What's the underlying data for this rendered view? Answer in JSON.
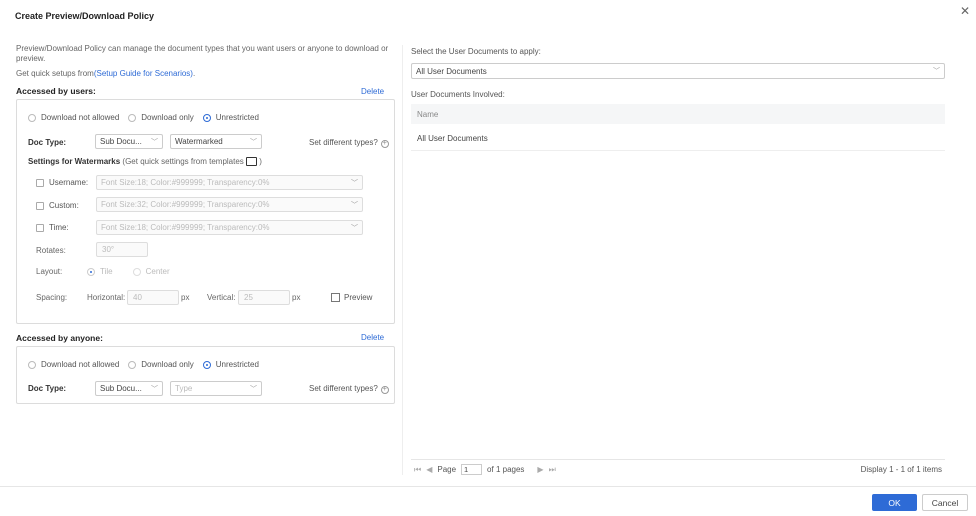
{
  "dialog": {
    "title": "Create Preview/Download Policy",
    "description": "Preview/Download Policy can manage the document types that you want users or anyone to download or preview.",
    "quick_setup_prefix": "Get quick setups from",
    "quick_setup_link": "(Setup Guide for Scenarios)",
    "quick_setup_suffix": "."
  },
  "users_section": {
    "title": "Accessed by users:",
    "delete": "Delete",
    "radios": [
      "Download not allowed",
      "Download only",
      "Unrestricted"
    ],
    "selected_radio": "Unrestricted",
    "doc_type_label": "Doc Type:",
    "doc_type_value": "Sub Docu...",
    "watermark_value": "Watermarked",
    "set_different": "Set different types?",
    "watermark_settings_title": "Settings for Watermarks",
    "watermark_settings_hint": "(Get quick settings from templates",
    "watermark_settings_hint_end": ")",
    "username_label": "Username:",
    "username_value": "Font Size:18;  Color:#999999;  Transparency:0%",
    "custom_label": "Custom:",
    "custom_value": "Font Size:32;  Color:#999999;  Transparency:0%",
    "time_label": "Time:",
    "time_value": "Font Size:18;  Color:#999999;  Transparency:0%",
    "rotates_label": "Rotates:",
    "rotates_value": "30°",
    "layout_label": "Layout:",
    "layout_tile": "Tile",
    "layout_center": "Center",
    "spacing_label": "Spacing:",
    "horizontal_label": "Horizontal:",
    "horizontal_value": "40",
    "horizontal_unit": "px",
    "vertical_label": "Vertical:",
    "vertical_value": "25",
    "vertical_unit": "px",
    "preview": "Preview"
  },
  "anyone_section": {
    "title": "Accessed by anyone:",
    "delete": "Delete",
    "radios": [
      "Download not allowed",
      "Download only",
      "Unrestricted"
    ],
    "selected_radio": "Unrestricted",
    "doc_type_label": "Doc Type:",
    "doc_type_value": "Sub Docu...",
    "type_placeholder": "Type",
    "set_different": "Set different types?"
  },
  "right_panel": {
    "select_label": "Select the User Documents to apply:",
    "select_value": "All User Documents",
    "involved_label": "User Documents Involved:",
    "table_header": "Name",
    "rows": [
      "All User Documents"
    ],
    "pager": {
      "page_label": "Page",
      "page_value": "1",
      "of_pages": "of 1 pages",
      "display": "Display 1 - 1 of 1 items"
    }
  },
  "footer": {
    "ok": "OK",
    "cancel": "Cancel"
  },
  "colors": {
    "accent": "#2e6bd6"
  }
}
